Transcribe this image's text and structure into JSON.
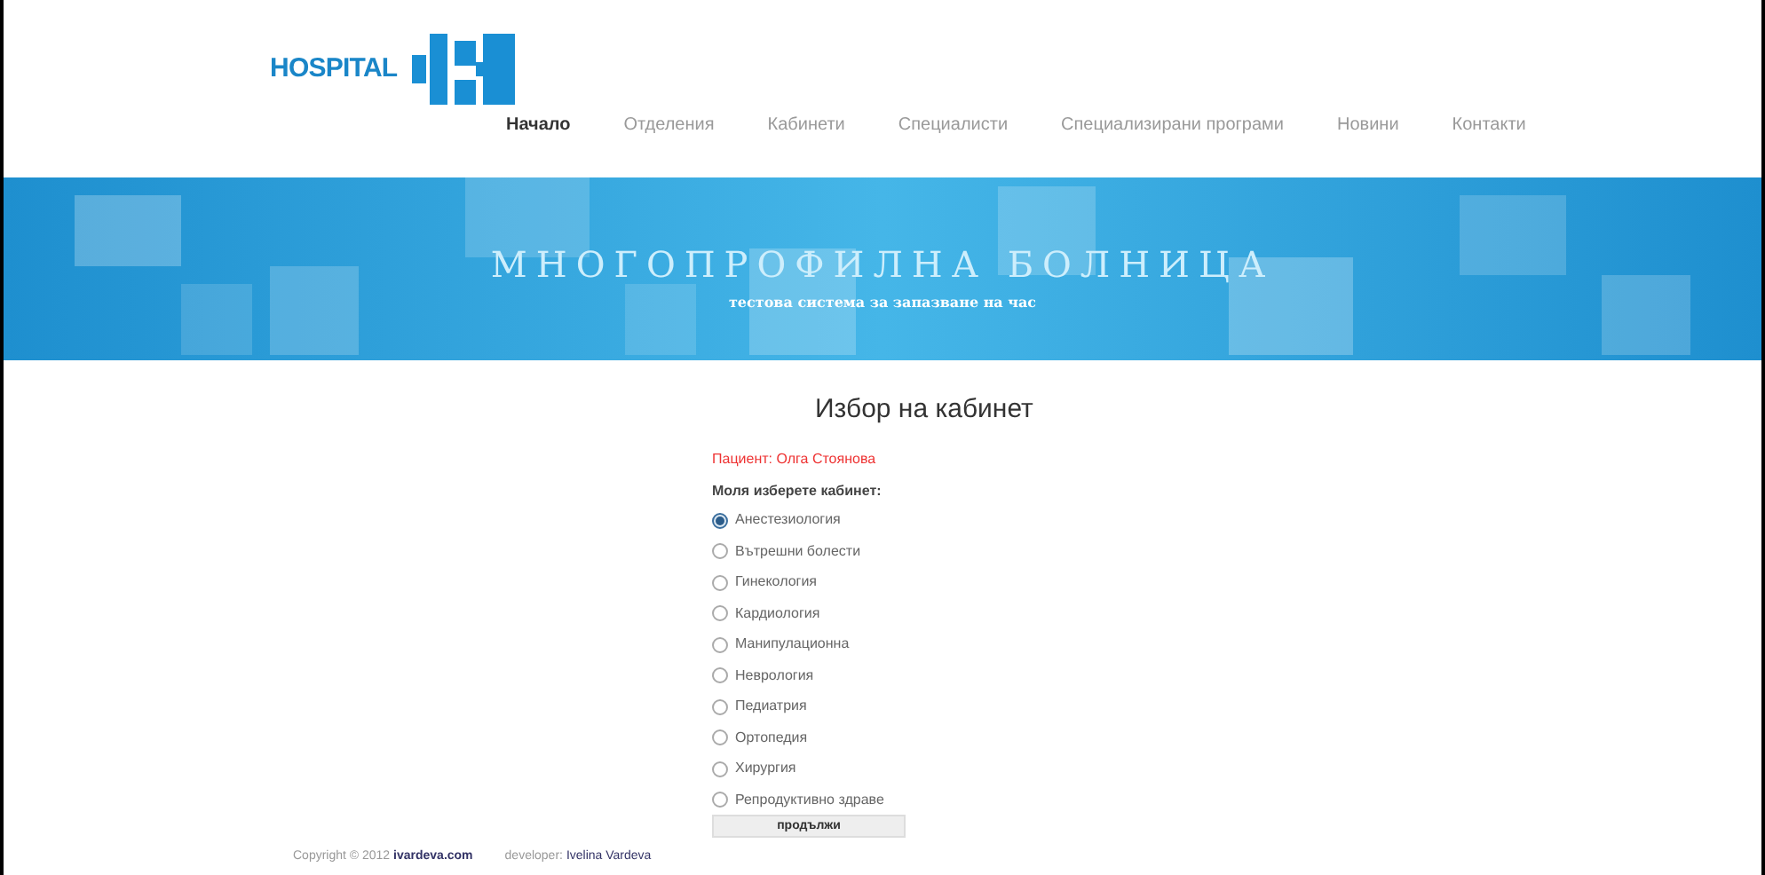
{
  "logo": {
    "text": "HOSPITAL"
  },
  "nav": [
    {
      "label": "Начало",
      "selected": true
    },
    {
      "label": "Отделения",
      "selected": false
    },
    {
      "label": "Кабинети",
      "selected": false
    },
    {
      "label": "Специалисти",
      "selected": false
    },
    {
      "label": "Специализирани програми",
      "selected": false
    },
    {
      "label": "Новини",
      "selected": false
    },
    {
      "label": "Контакти",
      "selected": false
    }
  ],
  "banner": {
    "title": "МНОГОПРОФИЛНА БОЛНИЦА",
    "subtitle": "тестова система за запазване на час"
  },
  "form": {
    "heading": "Избор на кабинет",
    "patient": "Пациент: Олга Стоянова",
    "prompt": "Моля изберете кабинет:",
    "options": [
      {
        "label": "Анестезиология",
        "selected": true
      },
      {
        "label": "Вътрешни болести",
        "selected": false
      },
      {
        "label": "Гинекология",
        "selected": false
      },
      {
        "label": "Кардиология",
        "selected": false
      },
      {
        "label": "Манипулационна",
        "selected": false
      },
      {
        "label": "Неврология",
        "selected": false
      },
      {
        "label": "Педиатрия",
        "selected": false
      },
      {
        "label": "Ортопедия",
        "selected": false
      },
      {
        "label": "Хирургия",
        "selected": false
      },
      {
        "label": "Репродуктивно здраве",
        "selected": false
      }
    ],
    "button": "продължи"
  },
  "footer": {
    "copyright": "Copyright © 2012",
    "site": "ivardeva.com",
    "developer_label": "developer:",
    "developer": "Ivelina Vardeva"
  }
}
